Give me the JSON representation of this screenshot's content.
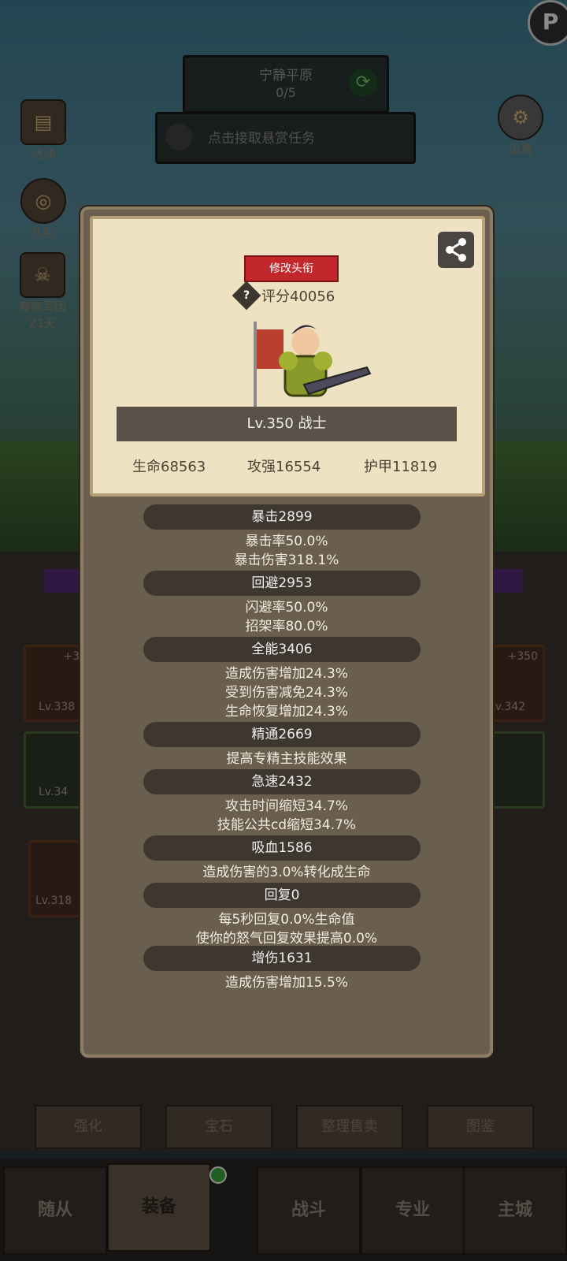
{
  "hud": {
    "stage_name": "宁静平原",
    "stage_progress": "0/5",
    "bounty_label": "点击接取悬赏任务",
    "side_left": [
      {
        "label": "活动"
      },
      {
        "label": "礼包"
      },
      {
        "label": "魔能军团",
        "sub": "21天"
      }
    ],
    "settings_label": "设置"
  },
  "profile": {
    "edit_title_button": "修改头衔",
    "score": "评分40056",
    "level_class": "Lv.350 战士",
    "basic_stats": [
      "生命68563",
      "攻强16554",
      "护甲11819"
    ]
  },
  "sections": [
    {
      "header": "暴击2899",
      "lines": [
        "暴击率50.0%",
        "暴击伤害318.1%"
      ]
    },
    {
      "header": "回避2953",
      "lines": [
        "闪避率50.0%",
        "招架率80.0%"
      ]
    },
    {
      "header": "全能3406",
      "lines": [
        "造成伤害增加24.3%",
        "受到伤害减免24.3%",
        "生命恢复增加24.3%"
      ]
    },
    {
      "header": "精通2669",
      "lines": [
        "提高专精主技能效果"
      ]
    },
    {
      "header": "急速2432",
      "lines": [
        "攻击时间缩短34.7%",
        "技能公共cd缩短34.7%"
      ]
    },
    {
      "header": "吸血1586",
      "lines": [
        "造成伤害的3.0%转化成生命"
      ]
    },
    {
      "header": "回复0",
      "lines": [
        "每5秒回复0.0%生命值",
        "使你的怒气回复效果提高0.0%"
      ]
    },
    {
      "header": "增伤1631",
      "lines": [
        "造成伤害增加15.5%"
      ]
    }
  ],
  "bg_slots": {
    "left1_level": "Lv.338",
    "left1_plus": "+3",
    "left2_level": "Lv.34",
    "left3_level": "Lv.318",
    "right1_level": "Lv.342",
    "right1_plus": "+350"
  },
  "tabs": [
    "强化",
    "宝石",
    "整理售卖",
    "图鉴"
  ],
  "nav": [
    "随从",
    "装备",
    "战斗",
    "专业",
    "主城"
  ]
}
